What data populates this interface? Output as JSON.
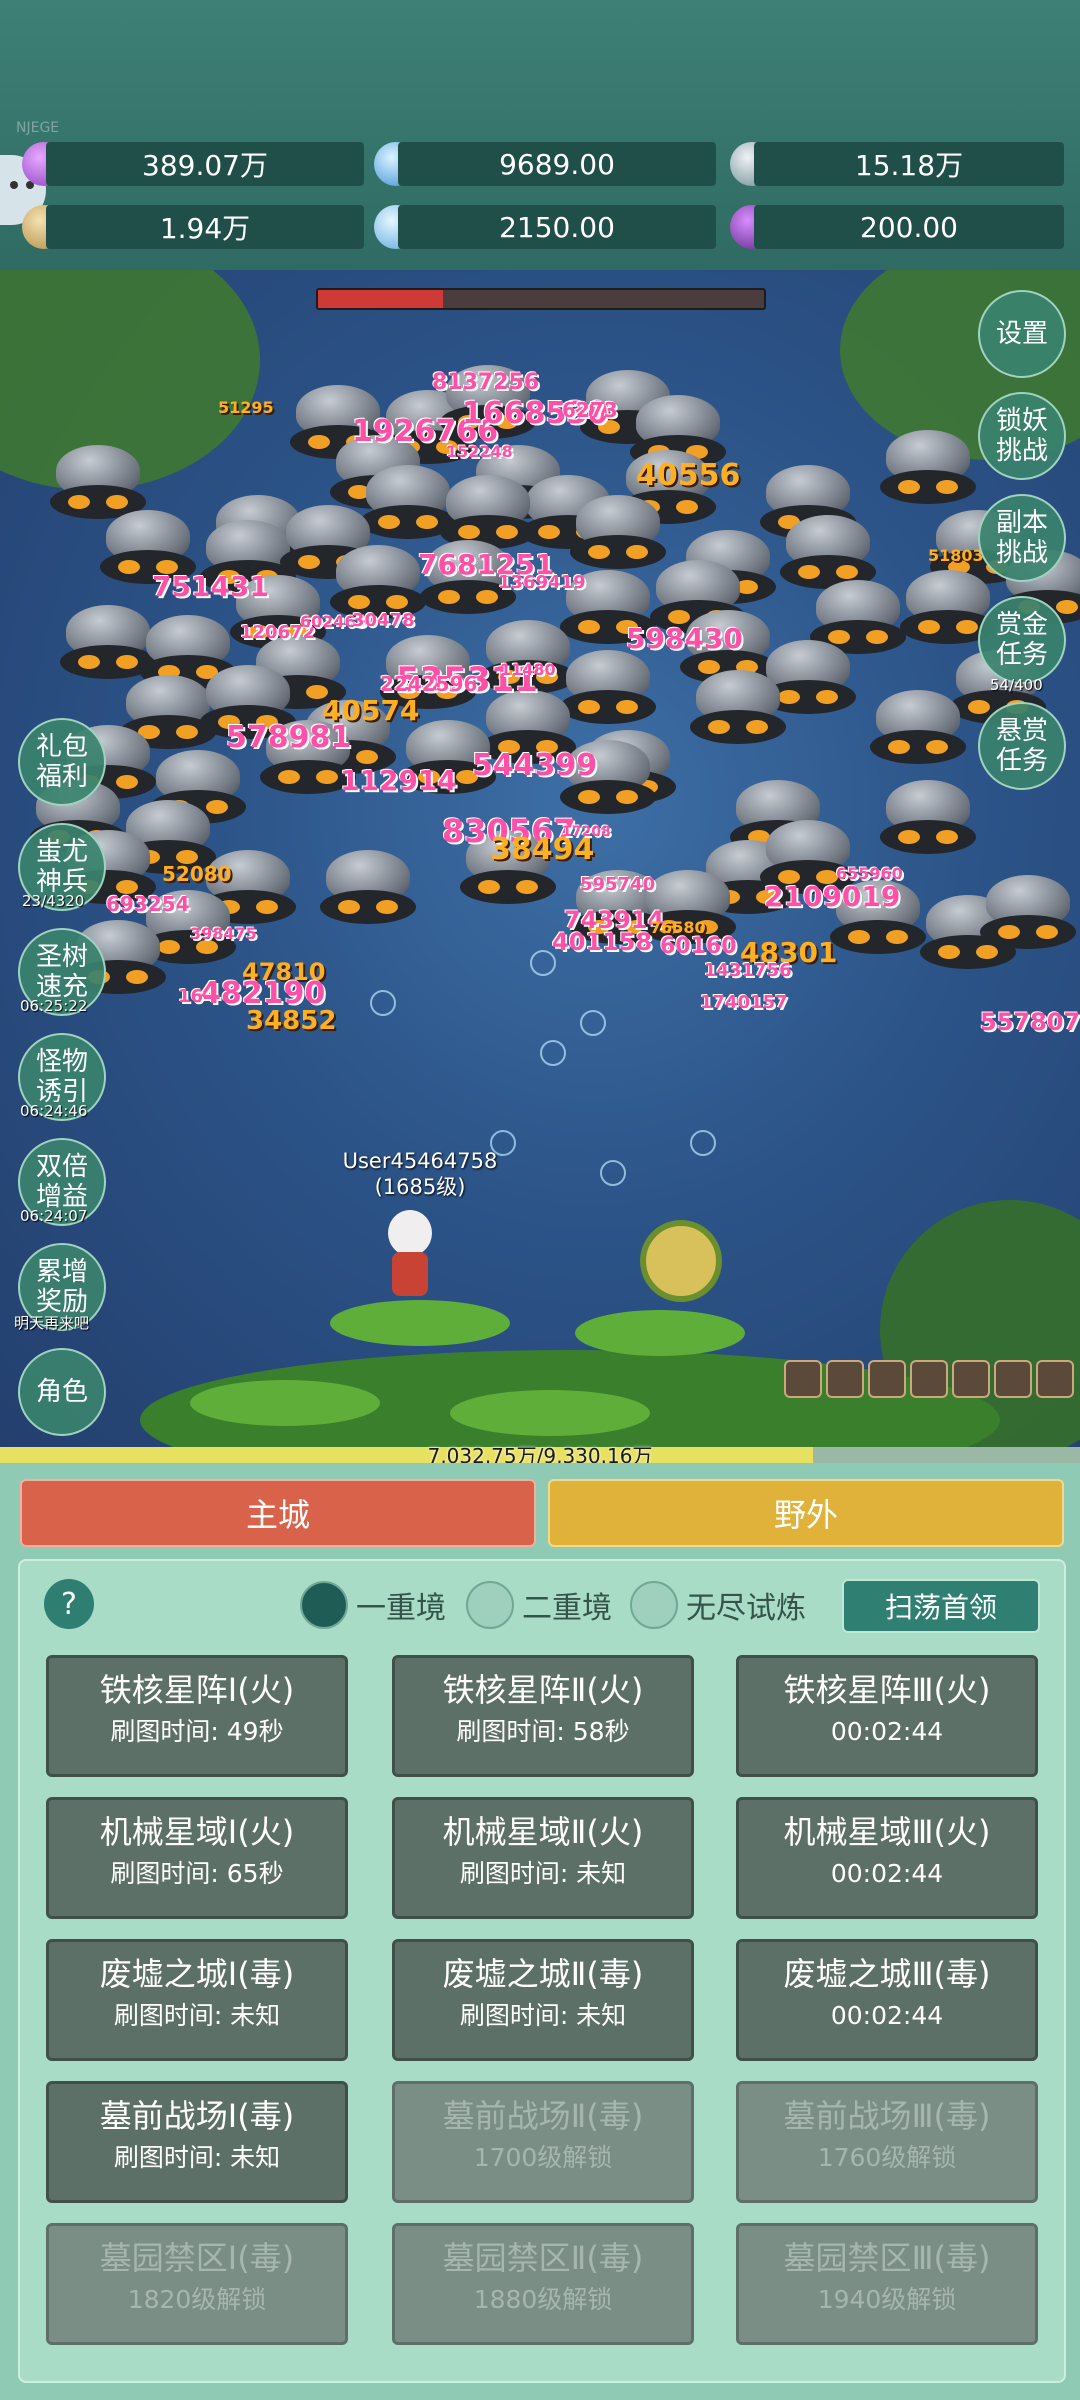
{
  "watermark": "NJEGE",
  "resources": [
    {
      "icon": "purple-gem-icon",
      "value": "389.07万"
    },
    {
      "icon": "blue-crystal-icon",
      "value": "9689.00"
    },
    {
      "icon": "silver-ore-icon",
      "value": "15.18万"
    },
    {
      "icon": "scroll-icon",
      "value": "1.94万"
    },
    {
      "icon": "ice-crystal-icon",
      "value": "2150.00"
    },
    {
      "icon": "purple-pot-icon",
      "value": "200.00"
    }
  ],
  "boss_hp_fraction": 0.28,
  "damage_numbers": [
    "51295",
    "8137256",
    "1926766",
    "1668530",
    "6273",
    "152248",
    "40556",
    "751431",
    "7681251",
    "1369419",
    "51803",
    "120672",
    "602465",
    "30478",
    "598430",
    "535311",
    "11480",
    "40574",
    "2242596",
    "578981",
    "544399",
    "112914",
    "830567",
    "38494",
    "17208",
    "52080",
    "595740",
    "693254",
    "743914",
    "76580",
    "2109019",
    "655960",
    "398475",
    "401158",
    "60160",
    "48301",
    "47810",
    "482190",
    "1431756",
    "1740157",
    "34852",
    "557807",
    "16"
  ],
  "player": {
    "name": "User45464758",
    "level": "(1685级)"
  },
  "left_buttons": [
    {
      "label": "礼包福利",
      "sub": ""
    },
    {
      "label": "蚩尤神兵",
      "sub": "23/4320"
    },
    {
      "label": "圣树速充",
      "sub": "06:25:22"
    },
    {
      "label": "怪物诱引",
      "sub": "06:24:46"
    },
    {
      "label": "双倍增益",
      "sub": "06:24:07"
    },
    {
      "label": "累增奖励",
      "sub": "明天再来吧"
    },
    {
      "label": "角色",
      "sub": ""
    }
  ],
  "right_buttons": [
    {
      "label": "设置",
      "sub": ""
    },
    {
      "label": "锁妖挑战",
      "sub": ""
    },
    {
      "label": "副本挑战",
      "sub": ""
    },
    {
      "label": "赏金任务",
      "sub": "54/400"
    },
    {
      "label": "悬赏任务",
      "sub": ""
    }
  ],
  "xp": {
    "text": "7,032.75万/9,330.16万",
    "fraction": 0.753
  },
  "tabs": {
    "home": "主城",
    "wild": "野外"
  },
  "help_label": "?",
  "modes": [
    {
      "label": "一重境",
      "selected": true
    },
    {
      "label": "二重境",
      "selected": false
    },
    {
      "label": "无尽试炼",
      "selected": false
    }
  ],
  "sweep_label": "扫荡首领",
  "stages": [
    {
      "title": "铁核星阵Ⅰ(火)",
      "sub": "刷图时间: 49秒",
      "locked": false
    },
    {
      "title": "铁核星阵Ⅱ(火)",
      "sub": "刷图时间: 58秒",
      "locked": false
    },
    {
      "title": "铁核星阵Ⅲ(火)",
      "sub": "00:02:44",
      "locked": false
    },
    {
      "title": "机械星域Ⅰ(火)",
      "sub": "刷图时间: 65秒",
      "locked": false
    },
    {
      "title": "机械星域Ⅱ(火)",
      "sub": "刷图时间: 未知",
      "locked": false
    },
    {
      "title": "机械星域Ⅲ(火)",
      "sub": "00:02:44",
      "locked": false
    },
    {
      "title": "废墟之城Ⅰ(毒)",
      "sub": "刷图时间: 未知",
      "locked": false
    },
    {
      "title": "废墟之城Ⅱ(毒)",
      "sub": "刷图时间: 未知",
      "locked": false
    },
    {
      "title": "废墟之城Ⅲ(毒)",
      "sub": "00:02:44",
      "locked": false
    },
    {
      "title": "墓前战场Ⅰ(毒)",
      "sub": "刷图时间: 未知",
      "locked": false
    },
    {
      "title": "墓前战场Ⅱ(毒)",
      "sub": "1700级解锁",
      "locked": true
    },
    {
      "title": "墓前战场Ⅲ(毒)",
      "sub": "1760级解锁",
      "locked": true
    },
    {
      "title": "墓园禁区Ⅰ(毒)",
      "sub": "1820级解锁",
      "locked": true
    },
    {
      "title": "墓园禁区Ⅱ(毒)",
      "sub": "1880级解锁",
      "locked": true
    },
    {
      "title": "墓园禁区Ⅲ(毒)",
      "sub": "1940级解锁",
      "locked": true
    }
  ],
  "colors": {
    "panel": "#a8dcc6",
    "card": "#5d7068",
    "home": "#d9624a",
    "wild": "#e0b23a",
    "damage": "#ff4fa6"
  }
}
